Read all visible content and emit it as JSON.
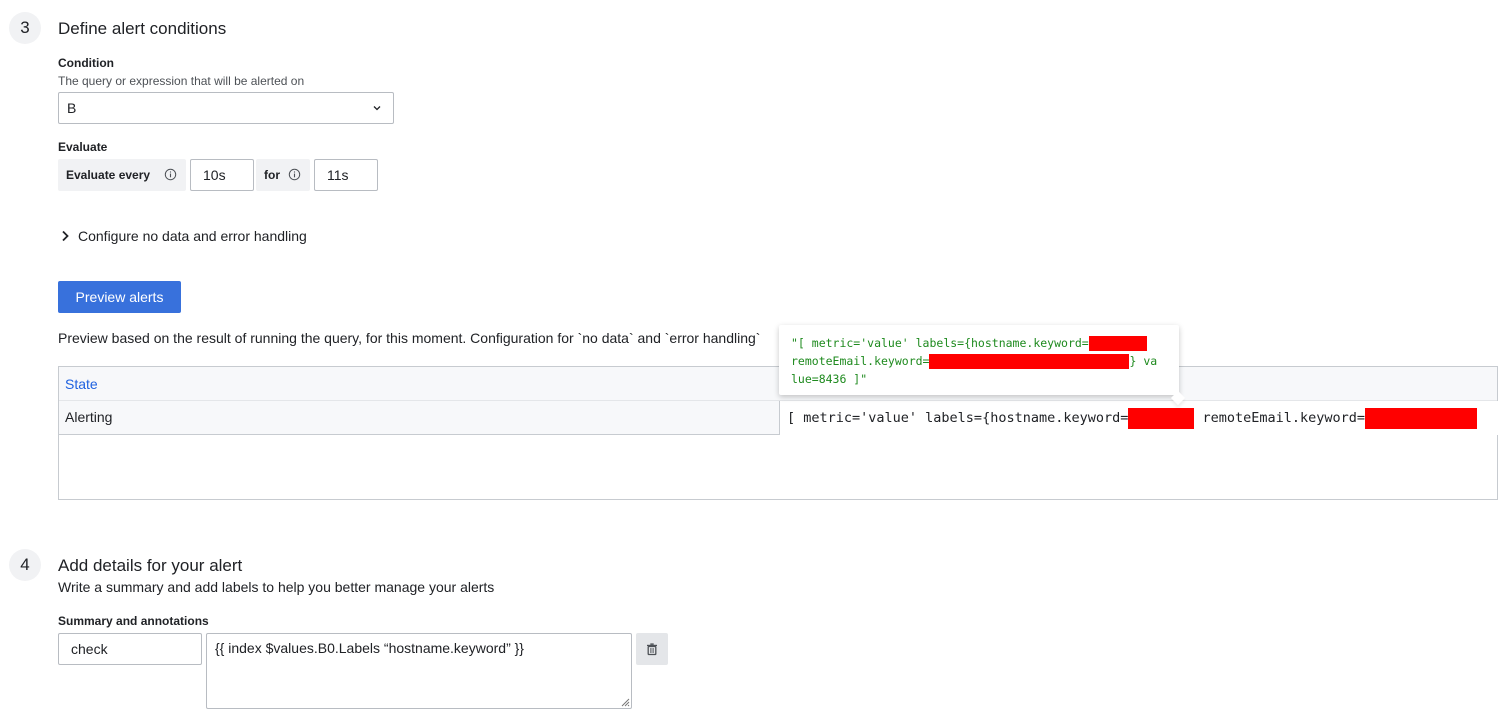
{
  "section3": {
    "number": "3",
    "title": "Define alert conditions",
    "condition": {
      "label": "Condition",
      "description": "The query or expression that will be alerted on",
      "selected": "B"
    },
    "evaluate": {
      "label": "Evaluate",
      "every_label": "Evaluate every",
      "every_value": "10s",
      "for_label": "for",
      "for_value": "11s"
    },
    "no_data_toggle": "Configure no data and error handling",
    "preview_button": "Preview alerts",
    "preview_description": "Preview based on the result of running the query, for this moment. Configuration for `no data` and `error handling`",
    "table": {
      "state_header": "State",
      "row_state": "Alerting",
      "row_labels_1": "[ metric='value' labels={hostname.keyword=",
      "row_labels_2": " remoteEmail.keyword="
    },
    "tooltip": {
      "line1": "\"[ metric='value' labels={hostname.keyword=",
      "line2a": "remoteEmail.keyword=",
      "line2b": "} va",
      "line3": "lue=8436 ]\""
    }
  },
  "section4": {
    "number": "4",
    "title": "Add details for your alert",
    "description": "Write a summary and add labels to help you better manage your alerts",
    "summary_label": "Summary and annotations",
    "annotation_key": "check",
    "annotation_value": "{{ index $values.B0.Labels “hostname.keyword” }}"
  },
  "colors": {
    "primary": "#3871dc",
    "link": "#1f62e0",
    "tooltip_text": "#1e8a1e",
    "redaction": "#ff0000"
  }
}
